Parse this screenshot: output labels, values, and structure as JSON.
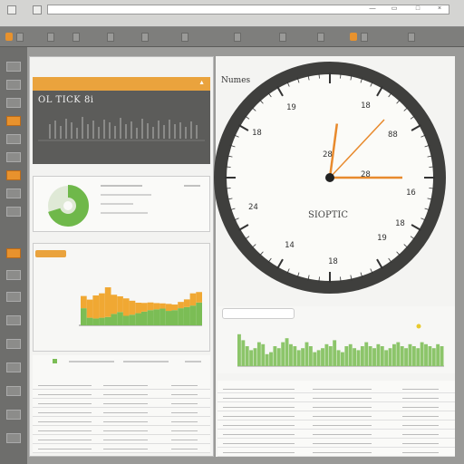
{
  "browser": {
    "address": ""
  },
  "toolbar": {
    "items": [
      "",
      "",
      "",
      "",
      "",
      "",
      "",
      "",
      "",
      ""
    ]
  },
  "sidebar": {
    "items": 14
  },
  "alert_card": {
    "banner": "",
    "title": "OL TICK 8i"
  },
  "clock": {
    "hour": 12,
    "minute": 15,
    "numerals": [
      "19",
      "18",
      "88",
      "18",
      "24",
      "19",
      "14",
      "18",
      "16",
      "18",
      "28",
      "28"
    ],
    "brand": "SIOPTIC",
    "hand_color": "#e88a2d"
  },
  "right_header": "Numes",
  "gauge": {
    "value": 0.3,
    "color": "#6fb84a"
  },
  "chart_panel": {
    "title": "",
    "yticks": [
      "",
      "",
      "",
      "",
      ""
    ],
    "xticks": [
      "",
      "",
      "",
      "",
      "",
      ""
    ]
  },
  "chart_data": {
    "type": "bar",
    "series": [
      {
        "color": "#f0a833",
        "values": [
          0.35,
          0.52,
          0.66,
          0.7,
          0.85,
          0.55,
          0.45,
          0.5,
          0.4,
          0.3,
          0.25,
          0.22,
          0.18,
          0.15,
          0.2,
          0.16,
          0.18,
          0.22,
          0.35,
          0.3
        ]
      },
      {
        "color": "#7bbd55",
        "values": [
          0.45,
          0.2,
          0.18,
          0.2,
          0.22,
          0.3,
          0.35,
          0.25,
          0.28,
          0.32,
          0.36,
          0.4,
          0.42,
          0.44,
          0.38,
          0.4,
          0.45,
          0.48,
          0.52,
          0.6
        ]
      }
    ]
  },
  "wave_chart": {
    "values": [
      0.8,
      0.65,
      0.5,
      0.4,
      0.45,
      0.6,
      0.55,
      0.3,
      0.35,
      0.5,
      0.45,
      0.6,
      0.7,
      0.55,
      0.5,
      0.4,
      0.45,
      0.6,
      0.5,
      0.35,
      0.4,
      0.45,
      0.55,
      0.5,
      0.65,
      0.4,
      0.35,
      0.5,
      0.55,
      0.45,
      0.4,
      0.5,
      0.6,
      0.5,
      0.45,
      0.55,
      0.5,
      0.4,
      0.45,
      0.55,
      0.6,
      0.5,
      0.45,
      0.55,
      0.5,
      0.45,
      0.6,
      0.55,
      0.5,
      0.45,
      0.55,
      0.5
    ],
    "color": "#8cc56a"
  },
  "tables": {
    "left_rows": 8,
    "right_rows": 8
  }
}
